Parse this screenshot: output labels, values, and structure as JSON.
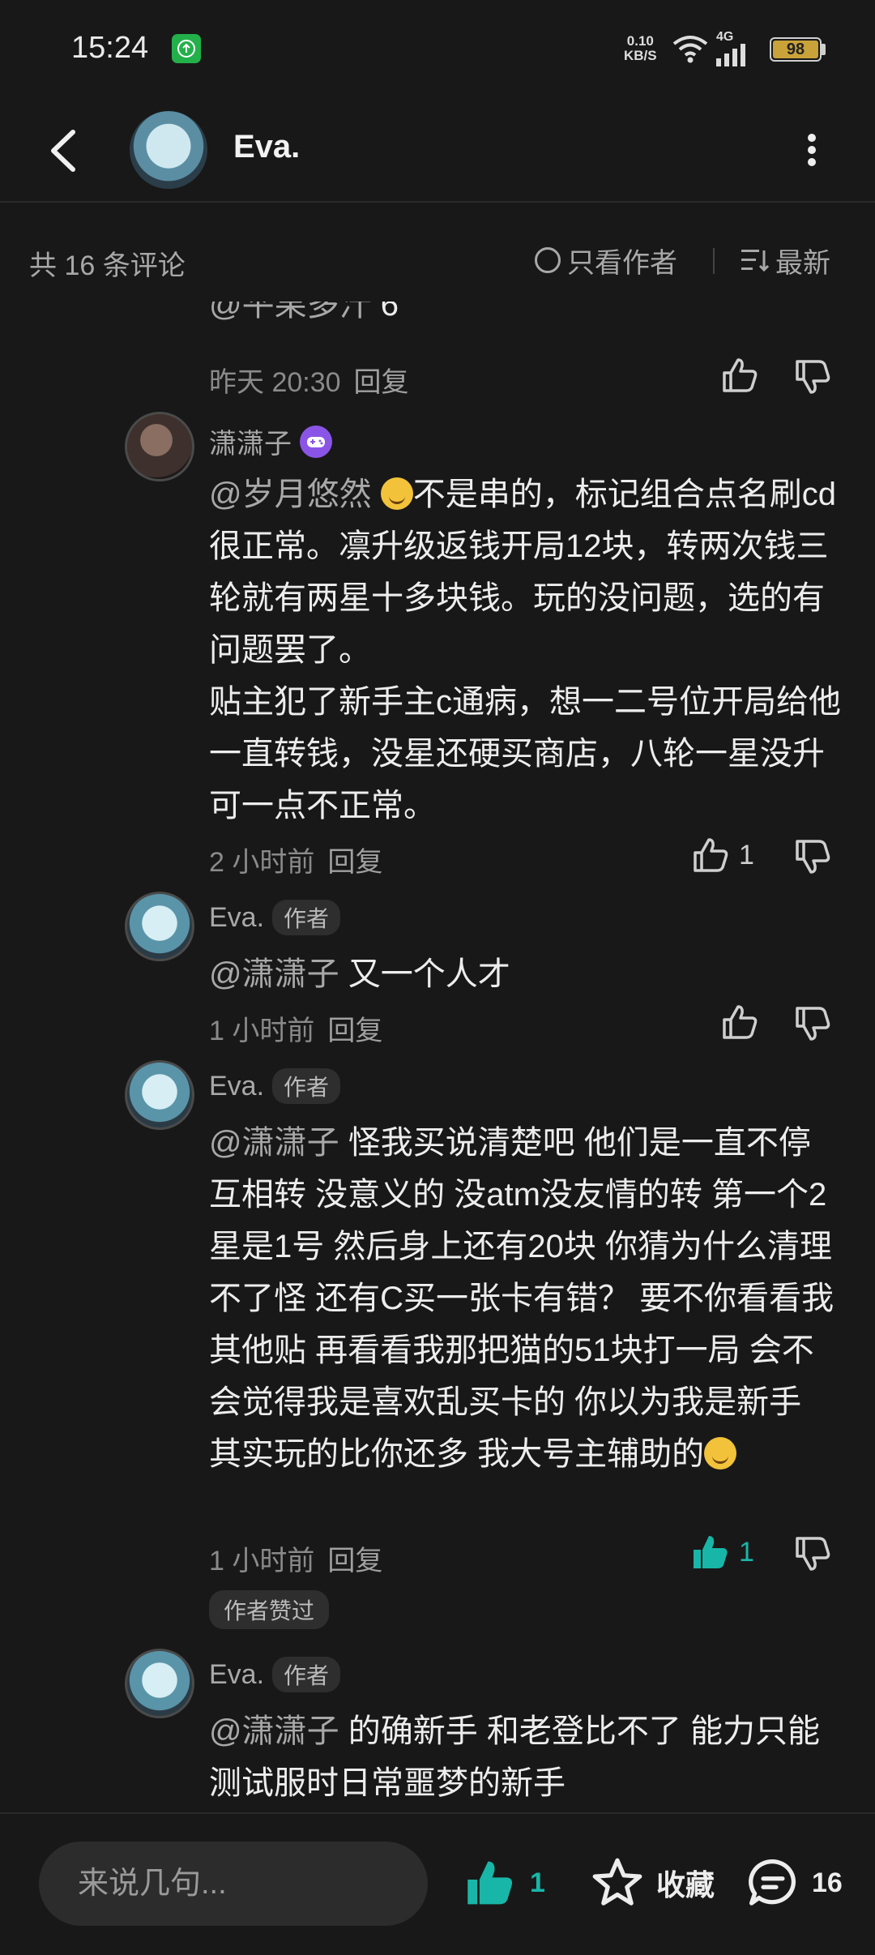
{
  "status_bar": {
    "time": "15:24",
    "net_speed_value": "0.10",
    "net_speed_unit": "KB/S",
    "network_type": "4G",
    "battery": "98"
  },
  "header": {
    "title": "Eva."
  },
  "filter": {
    "count": "共 16 条评论",
    "only_author": "只看作者",
    "sort": "最新"
  },
  "comments": [
    {
      "mention": "@平果多汁",
      "text": "6",
      "time": "昨天 20:30",
      "reply": "回复",
      "likes": ""
    },
    {
      "author": "潇潇子",
      "mention": "@岁月悠然",
      "text1": "不是串的，标记组合点名刷cd很正常。凛升级返钱开局12块，转两次钱三轮就有两星十多块钱。玩的没问题，选的有问题罢了。",
      "text2": "贴主犯了新手主c通病，想一二号位开局给他一直转钱，没星还硬买商店，八轮一星没升可一点不正常。",
      "time": "2 小时前",
      "reply": "回复",
      "likes": "1"
    },
    {
      "author": "Eva.",
      "tag": "作者",
      "mention": "@潇潇子",
      "text": "又一个人才",
      "time": "1 小时前",
      "reply": "回复",
      "likes": ""
    },
    {
      "author": "Eva.",
      "tag": "作者",
      "mention": "@潇潇子",
      "text": "怪我买说清楚吧 他们是一直不停互相转 没意义的 没atm没友情的转 第一个2星是1号 然后身上还有20块 你猜为什么清理不了怪 还有C买一张卡有错？ 要不你看看我其他贴 再看看我那把猫的51块打一局 会不会觉得我是喜欢乱买卡的 你以为我是新手 其实玩的比你还多 我大号主辅助的",
      "time": "1 小时前",
      "reply": "回复",
      "likes": "1",
      "author_liked": "作者赞过"
    },
    {
      "author": "Eva.",
      "tag": "作者",
      "mention": "@潇潇子",
      "text": "的确新手 和老登比不了 能力只能测试服时日常噩梦的新手"
    }
  ],
  "bottom_bar": {
    "input_placeholder": "来说几句...",
    "like_count": "1",
    "favorite_label": "收藏",
    "comment_count": "16"
  },
  "colors": {
    "background": "#181818",
    "accent": "#18b6a8",
    "secondary_text": "#a8a8a8"
  }
}
